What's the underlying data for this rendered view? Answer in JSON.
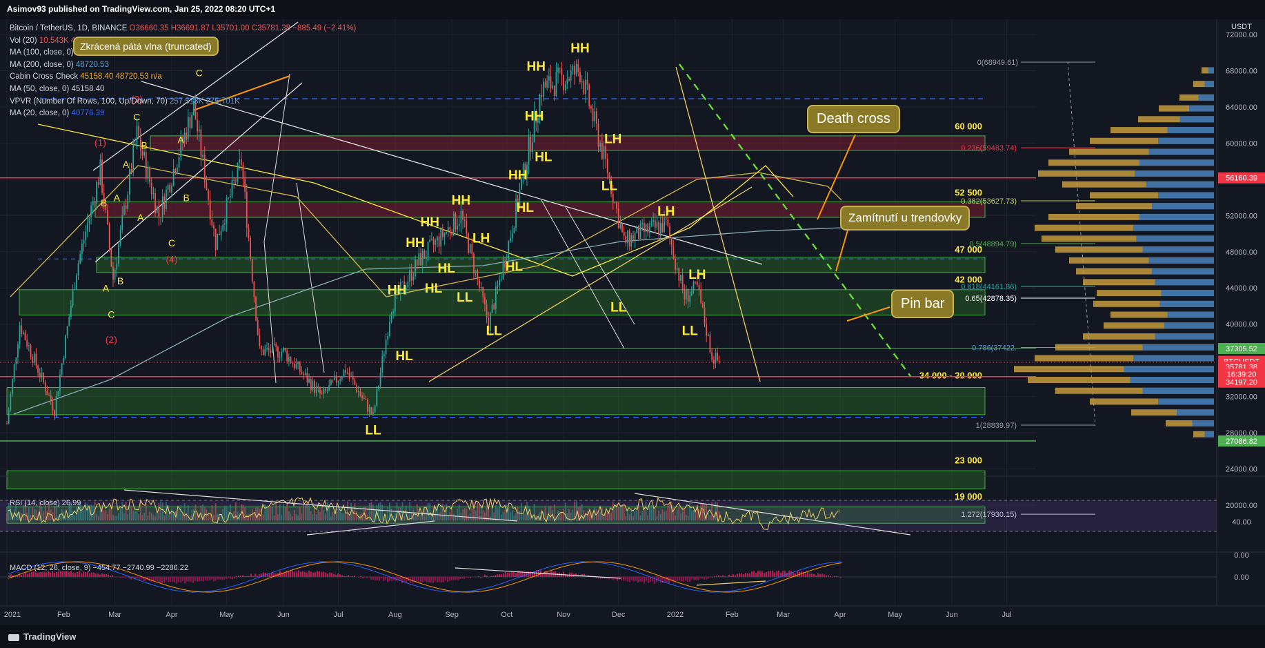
{
  "header": {
    "published": "Asimov93 published on TradingView.com, Jan 25, 2022 08:20 UTC+1"
  },
  "legend": [
    {
      "label": "Bitcoin / TetherUS, 1D, BINANCE",
      "values": [
        "O36660.35",
        "H36691.87",
        "L35701.00",
        "C35781.38",
        "−885.49 (−2.41%)"
      ],
      "color": "#ef5350"
    },
    {
      "label": "Vol (20)",
      "values": [
        "10.543K",
        "41.92K"
      ],
      "color": "#ef5350"
    },
    {
      "label": "MA (100, close, 0)",
      "values": [
        "45591.74"
      ],
      "color": "#f0b323"
    },
    {
      "label": "MA (200, close, 0)",
      "values": [
        "48720.53"
      ],
      "color": "#5ea1c7"
    },
    {
      "label": "Cabin Cross Check",
      "values": [
        "45158.40",
        "48720.53",
        "n/a"
      ],
      "color": "#f5a623"
    },
    {
      "label": "MA (50, close, 0)",
      "values": [
        "45158.40"
      ],
      "color": "#d1d4dc"
    },
    {
      "label": "VPVR (Number Of Rows, 100, Up/Down, 70)",
      "values": [
        "257.518K",
        "275.701K"
      ],
      "color": "#5b9bd5"
    },
    {
      "label": "MA (20, close, 0)",
      "values": [
        "40776.39"
      ],
      "color": "#2962ff"
    }
  ],
  "callouts": {
    "truncated": "Zkrácená pátá vlna (truncated)",
    "death_cross": "Death cross",
    "rejection": "Zamítnutí u trendovky",
    "pin_bar": "Pin bar"
  },
  "chart_data": {
    "type": "candlestick",
    "symbol": "BTCUSDT",
    "timeframe": "1D",
    "currency": "USDT",
    "ylim": [
      18000,
      74000
    ],
    "y_ticks": [
      20000,
      24000,
      28000,
      32000,
      36000,
      40000,
      44000,
      48000,
      52000,
      56000,
      60000,
      64000,
      68000,
      72000
    ],
    "x_ticks": [
      "2021",
      "Feb",
      "Mar",
      "Apr",
      "May",
      "Jun",
      "Jul",
      "Aug",
      "Sep",
      "Oct",
      "Nov",
      "Dec",
      "2022",
      "Feb",
      "Mar",
      "Apr",
      "May",
      "Jun",
      "Jul"
    ],
    "close_path": [
      [
        "2021-01-01",
        29000
      ],
      [
        "2021-01-08",
        40000
      ],
      [
        "2021-01-27",
        30500
      ],
      [
        "2021-02-08",
        46000
      ],
      [
        "2021-02-21",
        57000
      ],
      [
        "2021-02-28",
        45000
      ],
      [
        "2021-03-13",
        61000
      ],
      [
        "2021-03-25",
        52000
      ],
      [
        "2021-04-13",
        64000
      ],
      [
        "2021-04-25",
        49000
      ],
      [
        "2021-05-09",
        58000
      ],
      [
        "2021-05-19",
        37000
      ],
      [
        "2021-06-01",
        37000
      ],
      [
        "2021-06-22",
        32000
      ],
      [
        "2021-07-05",
        35000
      ],
      [
        "2021-07-20",
        29800
      ],
      [
        "2021-07-30",
        42000
      ],
      [
        "2021-08-14",
        47000
      ],
      [
        "2021-09-06",
        52000
      ],
      [
        "2021-09-21",
        40000
      ],
      [
        "2021-10-01",
        48000
      ],
      [
        "2021-10-20",
        66000
      ],
      [
        "2021-11-10",
        68000
      ],
      [
        "2021-11-25",
        57000
      ],
      [
        "2021-12-04",
        49000
      ],
      [
        "2021-12-12",
        50000
      ],
      [
        "2021-12-27",
        51000
      ],
      [
        "2022-01-06",
        43000
      ],
      [
        "2022-01-13",
        44000
      ],
      [
        "2022-01-21",
        36500
      ],
      [
        "2022-01-25",
        35781
      ]
    ],
    "last_close": 35781.38,
    "price_labels": [
      {
        "value": "72000.00",
        "price": 72000
      },
      {
        "value": "68000.00",
        "price": 68000
      },
      {
        "value": "64000.00",
        "price": 64000
      },
      {
        "value": "60000.00",
        "price": 60000
      },
      {
        "value": "56000.00",
        "price": 56000
      },
      {
        "value": "52000.00",
        "price": 52000
      },
      {
        "value": "48000.00",
        "price": 48000
      },
      {
        "value": "44000.00",
        "price": 44000
      },
      {
        "value": "40000.00",
        "price": 40000
      },
      {
        "value": "36000.00",
        "price": 36000
      },
      {
        "value": "32000.00",
        "price": 32000
      },
      {
        "value": "28000.00",
        "price": 28000
      },
      {
        "value": "24000.00",
        "price": 24000
      },
      {
        "value": "20000.00",
        "price": 20000
      }
    ],
    "axis_badges": [
      {
        "text": "56160.39",
        "price": 56160.39,
        "color": "#f23645"
      },
      {
        "text": "37305.52",
        "price": 37305.52,
        "color": "#4caf50"
      },
      {
        "text": "BTCUSDT",
        "price": 35900,
        "color": "#f23645"
      },
      {
        "text": "35781.38",
        "price": 35281,
        "color": "#f23645"
      },
      {
        "text": "16:39:20",
        "price": 34481,
        "color": "#f23645"
      },
      {
        "text": "34197.20",
        "price": 33597,
        "color": "#f23645"
      },
      {
        "text": "27086.82",
        "price": 27086.82,
        "color": "#4caf50"
      }
    ],
    "levels": [
      {
        "label": "60 000",
        "low": 59200,
        "high": 60800,
        "price": 61500
      },
      {
        "label": "52 500",
        "low": 51800,
        "high": 53500,
        "price": 54200
      },
      {
        "label": "47 000",
        "low": 45700,
        "high": 47400,
        "price": 47900
      },
      {
        "label": "42 000",
        "low": 41000,
        "high": 43800,
        "price": 44600
      },
      {
        "label": "34 000 - 30 000",
        "low": 30000,
        "high": 33000,
        "price": 34000
      },
      {
        "label": "23 000",
        "low": 21800,
        "high": 23800,
        "price": 24600
      },
      {
        "label": "19 000",
        "low": 18000,
        "high": 19800,
        "price": 20600
      }
    ],
    "fib_levels": [
      {
        "label": "0(68949.61)",
        "price": 68949.61,
        "color": "#9598a1"
      },
      {
        "label": "0.236(59483.74)",
        "price": 59483.74,
        "color": "#f23645"
      },
      {
        "label": "0.382(53627.73)",
        "price": 53627.73,
        "color": "#c9d26a"
      },
      {
        "label": "0.5(48894.79)",
        "price": 48894.79,
        "color": "#4caf50"
      },
      {
        "label": "0.618(44161.86)",
        "price": 44161.86,
        "color": "#26a69a"
      },
      {
        "label": "0.65(42878.35)",
        "price": 42878.35,
        "color": "#ffffff"
      },
      {
        "label": "0.786(37422.",
        "price": 37422,
        "color": "#5b9bd5"
      },
      {
        "label": "1(28839.97)",
        "price": 28839.97,
        "color": "#9598a1"
      },
      {
        "label": "1.272(17930.15)",
        "price": 17930.15,
        "color": "#d1d4dc"
      }
    ],
    "annotations": [
      {
        "text": "HH",
        "date": "2021-10-17",
        "price": 68000,
        "color": "#ffeb3b"
      },
      {
        "text": "HH",
        "date": "2021-11-10",
        "price": 70000,
        "color": "#ffeb3b"
      },
      {
        "text": "HH",
        "date": "2021-10-16",
        "price": 62500,
        "color": "#ffeb3b"
      },
      {
        "text": "HL",
        "date": "2021-10-21",
        "price": 58000,
        "color": "#ffeb3b"
      },
      {
        "text": "HH",
        "date": "2021-10-07",
        "price": 56000,
        "color": "#ffeb3b"
      },
      {
        "text": "HL",
        "date": "2021-10-11",
        "price": 52400,
        "color": "#ffeb3b"
      },
      {
        "text": "HH",
        "date": "2021-09-06",
        "price": 53200,
        "color": "#ffeb3b"
      },
      {
        "text": "HH",
        "date": "2021-08-20",
        "price": 50800,
        "color": "#ffeb3b"
      },
      {
        "text": "HH",
        "date": "2021-08-12",
        "price": 48500,
        "color": "#ffeb3b"
      },
      {
        "text": "HL",
        "date": "2021-08-29",
        "price": 45700,
        "color": "#ffeb3b"
      },
      {
        "text": "LH",
        "date": "2021-09-17",
        "price": 49000,
        "color": "#ffeb3b"
      },
      {
        "text": "HL",
        "date": "2021-10-05",
        "price": 45900,
        "color": "#ffeb3b"
      },
      {
        "text": "HL",
        "date": "2021-08-22",
        "price": 43500,
        "color": "#ffeb3b"
      },
      {
        "text": "LL",
        "date": "2021-09-08",
        "price": 42500,
        "color": "#ffeb3b"
      },
      {
        "text": "HH",
        "date": "2021-08-02",
        "price": 43300,
        "color": "#ffeb3b"
      },
      {
        "text": "LL",
        "date": "2021-09-24",
        "price": 38800,
        "color": "#ffeb3b"
      },
      {
        "text": "HL",
        "date": "2021-08-06",
        "price": 36000,
        "color": "#ffeb3b"
      },
      {
        "text": "LL",
        "date": "2021-07-20",
        "price": 27800,
        "color": "#ffeb3b"
      },
      {
        "text": "LH",
        "date": "2021-11-28",
        "price": 60000,
        "color": "#ffeb3b"
      },
      {
        "text": "LL",
        "date": "2021-11-26",
        "price": 54800,
        "color": "#ffeb3b"
      },
      {
        "text": "LH",
        "date": "2021-12-27",
        "price": 52000,
        "color": "#ffeb3b"
      },
      {
        "text": "LL",
        "date": "2021-12-01",
        "price": 41400,
        "color": "#ffeb3b"
      },
      {
        "text": "LH",
        "date": "2022-01-13",
        "price": 45000,
        "color": "#ffeb3b"
      },
      {
        "text": "LL",
        "date": "2022-01-09",
        "price": 38800,
        "color": "#ffeb3b"
      },
      {
        "text": "(5)",
        "date": "2021-04-16",
        "price": 71000,
        "color": "#f23645"
      },
      {
        "text": "C",
        "date": "2021-04-16",
        "price": 67400,
        "color": "#ffeb3b"
      },
      {
        "text": "(3)",
        "date": "2021-03-13",
        "price": 64500,
        "color": "#f23645"
      },
      {
        "text": "C",
        "date": "2021-03-13",
        "price": 62500,
        "color": "#ffeb3b"
      },
      {
        "text": "(1)",
        "date": "2021-02-21",
        "price": 59700,
        "color": "#f23645"
      },
      {
        "text": "B",
        "date": "2021-03-17",
        "price": 59400,
        "color": "#ffeb3b"
      },
      {
        "text": "A",
        "date": "2021-04-06",
        "price": 60000,
        "color": "#ffeb3b"
      },
      {
        "text": "A",
        "date": "2021-03-07",
        "price": 57300,
        "color": "#ffeb3b"
      },
      {
        "text": "B",
        "date": "2021-02-23",
        "price": 53000,
        "color": "#ffeb3b"
      },
      {
        "text": "A",
        "date": "2021-03-02",
        "price": 53600,
        "color": "#ffeb3b"
      },
      {
        "text": "B",
        "date": "2021-04-09",
        "price": 53600,
        "color": "#ffeb3b"
      },
      {
        "text": "A",
        "date": "2021-03-15",
        "price": 51400,
        "color": "#ffeb3b"
      },
      {
        "text": "C",
        "date": "2021-04-01",
        "price": 48600,
        "color": "#ffeb3b"
      },
      {
        "text": "(4)",
        "date": "2021-04-01",
        "price": 46800,
        "color": "#f23645"
      },
      {
        "text": "B",
        "date": "2021-03-04",
        "price": 44400,
        "color": "#ffeb3b"
      },
      {
        "text": "A",
        "date": "2021-02-24",
        "price": 43600,
        "color": "#ffeb3b"
      },
      {
        "text": "C",
        "date": "2021-02-27",
        "price": 40700,
        "color": "#ffeb3b"
      },
      {
        "text": "(2)",
        "date": "2021-02-27",
        "price": 37900,
        "color": "#f23645"
      }
    ]
  },
  "rsi": {
    "label": "RSI (14, close)",
    "value": "26.99",
    "ticks": [
      "40.00",
      "0.00"
    ]
  },
  "macd": {
    "label": "MACD (12, 26, close, 9)",
    "values": [
      "−454.77",
      "−2740.99",
      "−2286.22"
    ],
    "ticks": [
      "0.00"
    ]
  },
  "axis": {
    "currency": "USDT"
  },
  "footer": {
    "brand": "TradingView"
  }
}
